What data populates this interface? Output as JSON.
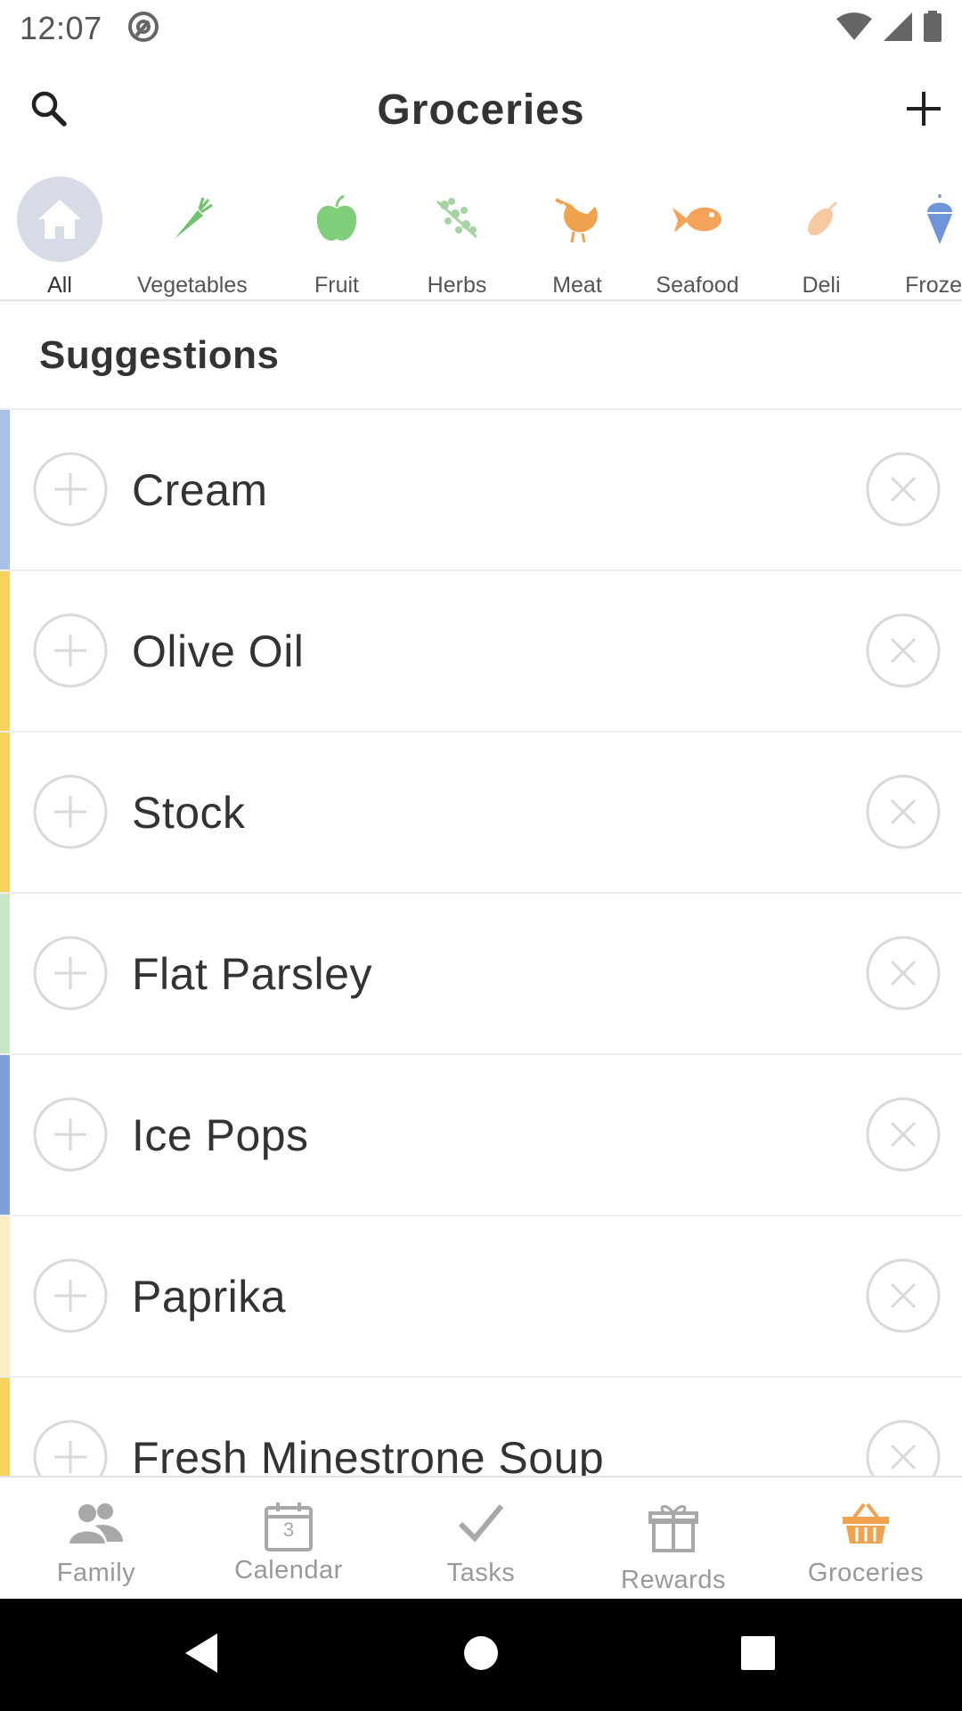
{
  "status_bar": {
    "time": "12:07"
  },
  "header": {
    "title": "Groceries",
    "search_icon": "search-icon",
    "add_icon": "plus-icon"
  },
  "categories": [
    {
      "label": "All",
      "icon": "home-icon",
      "selected": true
    },
    {
      "label": "Vegetables",
      "icon": "carrot-icon",
      "color": "#6fc36f"
    },
    {
      "label": "Fruit",
      "icon": "apple-icon",
      "color": "#7fcf7a"
    },
    {
      "label": "Herbs",
      "icon": "herb-icon",
      "color": "#a7d3a4"
    },
    {
      "label": "Meat",
      "icon": "chicken-icon",
      "color": "#f0a24e"
    },
    {
      "label": "Seafood",
      "icon": "fish-icon",
      "color": "#f4a45a"
    },
    {
      "label": "Deli",
      "icon": "sausage-icon",
      "color": "#f6c9a0"
    },
    {
      "label": "Frozen",
      "icon": "ice-cream-icon",
      "color": "#6f95d8"
    }
  ],
  "suggestions": {
    "title": "Suggestions",
    "items": [
      {
        "label": "Cream",
        "color": "#a9c1e8"
      },
      {
        "label": "Olive Oil",
        "color": "#f6d35b"
      },
      {
        "label": "Stock",
        "color": "#f6d35b"
      },
      {
        "label": "Flat Parsley",
        "color": "#c9e6c6"
      },
      {
        "label": "Ice Pops",
        "color": "#7f9fd9"
      },
      {
        "label": "Paprika",
        "color": "#fbeec4"
      },
      {
        "label": "Fresh Minestrone Soup",
        "color": "#f6d35b"
      }
    ]
  },
  "bottom_nav": [
    {
      "label": "Family",
      "icon": "family-icon"
    },
    {
      "label": "Calendar",
      "icon": "calendar-icon",
      "badge": "3"
    },
    {
      "label": "Tasks",
      "icon": "checkmark-icon"
    },
    {
      "label": "Rewards",
      "icon": "gift-icon"
    },
    {
      "label": "Groceries",
      "icon": "basket-icon",
      "active": true
    }
  ],
  "colors": {
    "accent": "#f0a24e",
    "nav_inactive": "#999999",
    "selected_bg": "#d6dbe6"
  }
}
